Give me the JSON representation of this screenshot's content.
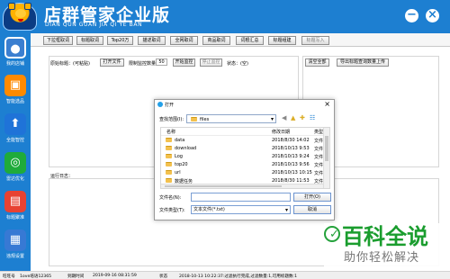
{
  "app": {
    "title": "店群管家企业版",
    "subtitle": "DIAN QUN GUAN JIA QI YE BAN",
    "minimize_icon": "−",
    "close_icon": "×"
  },
  "sidebar": {
    "items": [
      {
        "label": "我的店铺",
        "icon": "user-icon",
        "color": "#3b7fd0",
        "glyph": "●"
      },
      {
        "label": "智能选品",
        "icon": "shopping-bag-icon",
        "color": "#ff8a00",
        "glyph": "▣"
      },
      {
        "label": "全能智控",
        "icon": "upload-icon",
        "color": "#1f73d8",
        "glyph": "⬆"
      },
      {
        "label": "雷达优化",
        "icon": "radar-icon",
        "color": "#1fab3a",
        "glyph": "◎"
      },
      {
        "label": "标题聚准",
        "icon": "title-icon",
        "color": "#e84232",
        "glyph": "▤"
      },
      {
        "label": "违规设置",
        "icon": "settings-icon",
        "color": "#3779d4",
        "glyph": "▦"
      }
    ]
  },
  "toolbar": {
    "buttons": [
      "下拉框取词",
      "标题取词",
      "Top20万",
      "描述取词",
      "全网取词",
      "商品取词",
      "词根汇总",
      "标题组建",
      "标题写入"
    ]
  },
  "main": {
    "title_label": "原始标题：(可粘贴)",
    "open_file": "打开文件",
    "limit_label": "限制监控数量",
    "limit_value": "50",
    "start_monitor": "开始监控",
    "stop_monitor": "停止监控",
    "status_label": "状态：(空)",
    "clear_all": "清空全部",
    "export_upload": "导出标题查询数量上传",
    "log_label": "运行日志："
  },
  "dialog": {
    "title": "打开",
    "lookin_label": "查找范围(I):",
    "lookin_value": "files",
    "columns": {
      "name": "名称",
      "modified": "修改日期",
      "type": "类型"
    },
    "files": [
      {
        "name": "data",
        "modified": "2018/8/30 14:02",
        "type": "文件"
      },
      {
        "name": "download",
        "modified": "2018/10/13 9:53",
        "type": "文件"
      },
      {
        "name": "Log",
        "modified": "2018/10/13 9:24",
        "type": "文件"
      },
      {
        "name": "top20",
        "modified": "2018/10/13 9:56",
        "type": "文件"
      },
      {
        "name": "url",
        "modified": "2018/10/13 10:15",
        "type": "文件"
      },
      {
        "name": "数据任务",
        "modified": "2018/8/30 11:53",
        "type": "文件"
      }
    ],
    "filename_label": "文件名(N):",
    "filename_value": "",
    "filetype_label": "文件类型(T):",
    "filetype_value": "文本文件(*.txt)",
    "open_button": "打开(O)",
    "cancel_button": "取消"
  },
  "status": {
    "user_label": "旺旺号",
    "user_value": "1ove培语12365",
    "expire_label": "到期时间",
    "expire_value": "2019-09-16 08:31:59",
    "state_label": "状态",
    "state_value": "2018-10-13 10:22:37:过滤执行完成,过滤数量:1,可用标题数:1"
  },
  "watermark": {
    "title": "百科全说",
    "subtitle": "助你轻松解决"
  },
  "colors": {
    "brand_blue": "#1d7fd1",
    "watermark_green": "#1a9d2e"
  }
}
